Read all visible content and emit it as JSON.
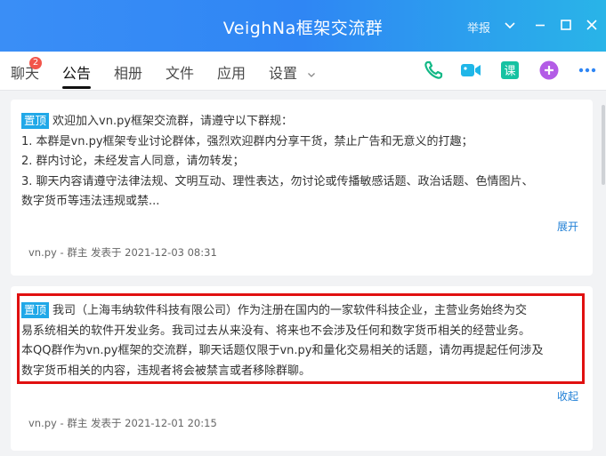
{
  "window": {
    "title": "VeighNa框架交流群",
    "report": "举报",
    "accent": "#2f86f4"
  },
  "tabs": [
    {
      "label": "聊天",
      "badge": "2"
    },
    {
      "label": "公告"
    },
    {
      "label": "相册"
    },
    {
      "label": "文件"
    },
    {
      "label": "应用"
    },
    {
      "label": "设置"
    }
  ],
  "toolbar_icons": [
    "phone-icon",
    "video-icon",
    "course-icon",
    "add-app-icon",
    "more-icon"
  ],
  "notices": [
    {
      "pin": "置顶",
      "lines": [
        "欢迎加入vn.py框架交流群，请遵守以下群规：",
        "1. 本群是vn.py框架专业讨论群体，强烈欢迎群内分享干货，禁止广告和无意义的打趣；",
        "2. 群内讨论，未经发言人同意，请勿转发；",
        "3. 聊天内容请遵守法律法规、文明互动、理性表达，勿讨论或传播敏感话题、政治话题、色情图片、",
        "数字货币等违法违规或禁..."
      ],
      "action": "展开",
      "meta": "vn.py - 群主  发表于 2021-12-03 08:31"
    },
    {
      "pin": "置顶",
      "lines": [
        "我司（上海韦纳软件科技有限公司）作为注册在国内的一家软件科技企业，主营业务始终为交",
        "易系统相关的软件开发业务。我司过去从来没有、将来也不会涉及任何和数字货币相关的经营业务。",
        "本QQ群作为vn.py框架的交流群，聊天话题仅限于vn.py和量化交易相关的话题，请勿再提起任何涉及",
        "数字货币相关的内容，违规者将会被禁言或者移除群聊。"
      ],
      "action": "收起",
      "meta": "vn.py - 群主  发表于 2021-12-01 20:15"
    }
  ]
}
